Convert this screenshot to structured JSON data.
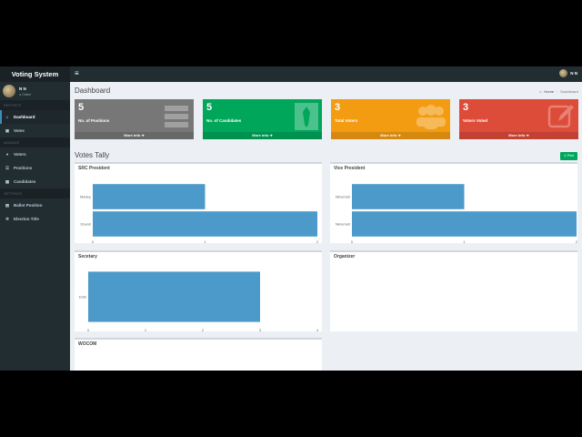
{
  "app": {
    "title": "Voting System"
  },
  "topbar": {
    "user_name": "N N"
  },
  "sidebar": {
    "user_name": "N N",
    "user_status": "● Online",
    "sections": [
      {
        "header": "REPORTS",
        "items": [
          {
            "label": "Dashboard",
            "icon": "dashboard-icon",
            "active": true
          },
          {
            "label": "Votes",
            "icon": "lock-icon"
          }
        ]
      },
      {
        "header": "MANAGE",
        "items": [
          {
            "label": "Voters",
            "icon": "users-icon"
          },
          {
            "label": "Positions",
            "icon": "tasks-icon"
          },
          {
            "label": "Candidates",
            "icon": "black-tie-icon"
          }
        ]
      },
      {
        "header": "SETTINGS",
        "items": [
          {
            "label": "Ballot Position",
            "icon": "file-icon"
          },
          {
            "label": "Election Title",
            "icon": "cog-icon"
          }
        ]
      }
    ]
  },
  "header": {
    "title": "Dashboard",
    "breadcrumb_home": "Home",
    "breadcrumb_current": "Dashboard"
  },
  "stats": [
    {
      "value": "5",
      "label": "No. of Positions",
      "more": "More info",
      "color": "#777777",
      "icon": "tasks-icon"
    },
    {
      "value": "5",
      "label": "No. of Candidates",
      "more": "More info",
      "color": "#00a65a",
      "icon": "black-tie-icon"
    },
    {
      "value": "3",
      "label": "Total Voters",
      "more": "More info",
      "color": "#f39c12",
      "icon": "users-icon"
    },
    {
      "value": "3",
      "label": "Voters Voted",
      "more": "More info",
      "color": "#dd4b39",
      "icon": "edit-icon"
    }
  ],
  "votes_tally": {
    "title": "Votes Tally",
    "print_label": "Print"
  },
  "chart_data": [
    {
      "type": "bar",
      "orientation": "horizontal",
      "title": "SRC President",
      "categories": [
        "Marley",
        "Dovah"
      ],
      "values": [
        1,
        2
      ],
      "xlim": [
        0,
        2
      ],
      "ticks": [
        "0",
        "1",
        "2"
      ]
    },
    {
      "type": "bar",
      "orientation": "horizontal",
      "title": "Vice President",
      "categories": [
        "Nkrumah",
        "Nkrumah"
      ],
      "values": [
        1,
        2
      ],
      "xlim": [
        0,
        2
      ],
      "ticks": [
        "0",
        "1",
        "2"
      ]
    },
    {
      "type": "bar",
      "orientation": "horizontal",
      "title": "Secetary",
      "categories": [
        "Dofs"
      ],
      "values": [
        3
      ],
      "xlim": [
        0,
        4
      ],
      "ticks": [
        "0",
        "1",
        "2",
        "3",
        "4"
      ]
    },
    {
      "type": "bar",
      "orientation": "horizontal",
      "title": "Organizer",
      "categories": [],
      "values": []
    },
    {
      "type": "bar",
      "orientation": "horizontal",
      "title": "WOCOM",
      "categories": [],
      "values": []
    }
  ]
}
